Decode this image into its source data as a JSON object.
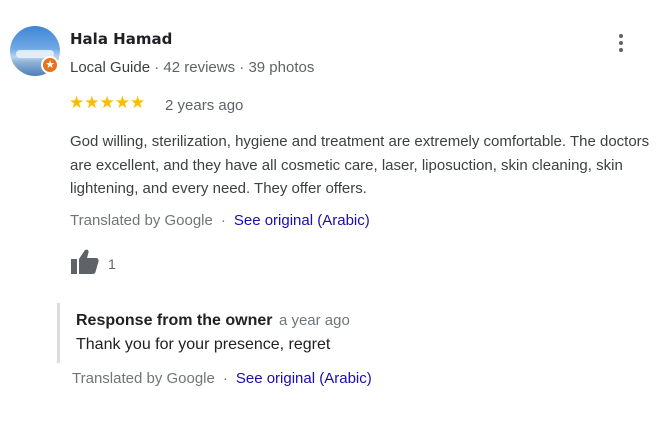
{
  "reviewer": {
    "name": "Hala Hamad",
    "level": "Local Guide",
    "reviews": "42 reviews",
    "photos": "39 photos",
    "separator": "·",
    "badge_icon": "star"
  },
  "review": {
    "rating": 5,
    "stars": "★★★★★",
    "age": "2 years ago",
    "text": "God willing, sterilization, hygiene and treatment are extremely comfortable. The doctors are excellent, and they have all cosmetic care, laser, liposuction, skin cleaning, skin lightening, and every need. They offer offers.",
    "translated_by": "Translated by Google",
    "dot": "·",
    "see_original": "See original (Arabic)",
    "likes": "1"
  },
  "owner_response": {
    "title": "Response from the owner",
    "age": "a year ago",
    "text": "Thank you for your presence, regret",
    "translated_by": "Translated by Google",
    "dot": "·",
    "see_original": "See original (Arabic)"
  },
  "colors": {
    "star": "#fbbc04",
    "link": "#1a0dab",
    "badge": "#e8711c",
    "muted": "#70757a"
  }
}
